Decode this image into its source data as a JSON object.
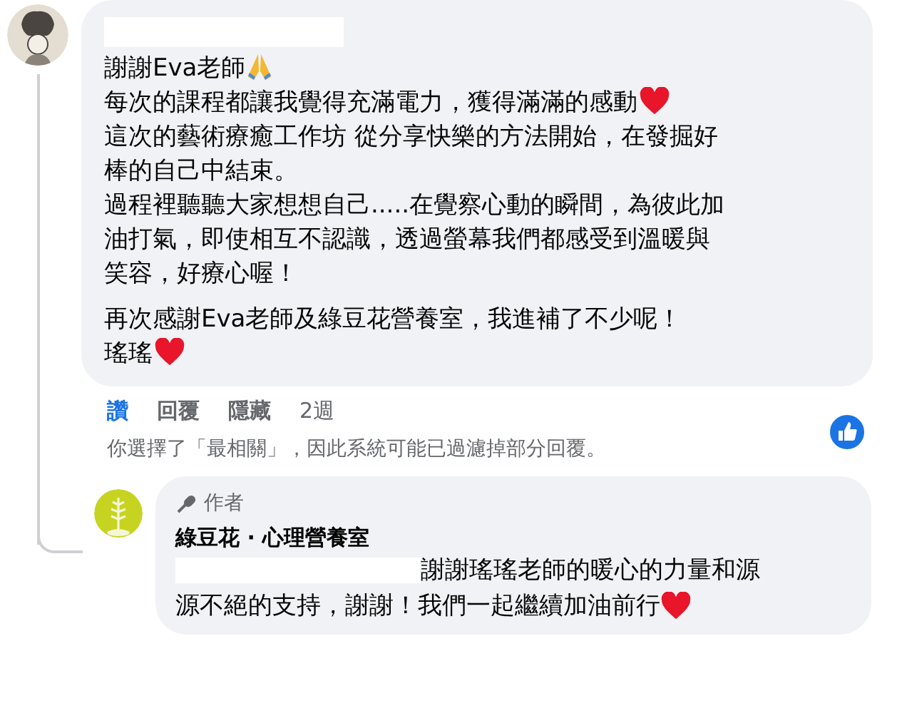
{
  "comment": {
    "author_redacted": true,
    "paragraphs": [
      [
        {
          "text": "謝謝Eva老師",
          "prayer_emoji": true
        },
        {
          "text": "每次的課程都讓我覺得充滿電力，獲得滿滿的感動",
          "heart_emoji": true
        },
        {
          "text": "這次的藝術療癒工作坊 從分享快樂的方法開始，在發掘好"
        },
        {
          "text": "棒的自己中結束。"
        },
        {
          "text": "過程裡聽聽大家想想自己.....在覺察心動的瞬間，為彼此加"
        },
        {
          "text": "油打氣，即使相互不認識，透過螢幕我們都感受到溫暖與"
        },
        {
          "text": "笑容，好療心喔！"
        }
      ],
      [
        {
          "text": "再次感謝Eva老師及綠豆花營養室，我進補了不少呢！"
        },
        {
          "text": "瑤瑤",
          "heart_emoji": true
        }
      ]
    ],
    "actions": [
      {
        "label": "讚",
        "selected": true
      },
      {
        "label": "回覆",
        "selected": false
      },
      {
        "label": "隱藏",
        "selected": false
      }
    ],
    "time": "2週",
    "liked": true
  },
  "filter_note": "你選擇了「最相關」，因此系統可能已過濾掉部分回覆。",
  "reply": {
    "badge": "作者",
    "author": "綠豆花 · 心理營養室",
    "mention_redacted": true,
    "lines": [
      {
        "text": "謝謝瑤瑤老師的暖心的力量和源"
      },
      {
        "text": "源不絕的支持，謝謝！我們一起繼續加油前行",
        "heart_emoji": true
      }
    ]
  }
}
